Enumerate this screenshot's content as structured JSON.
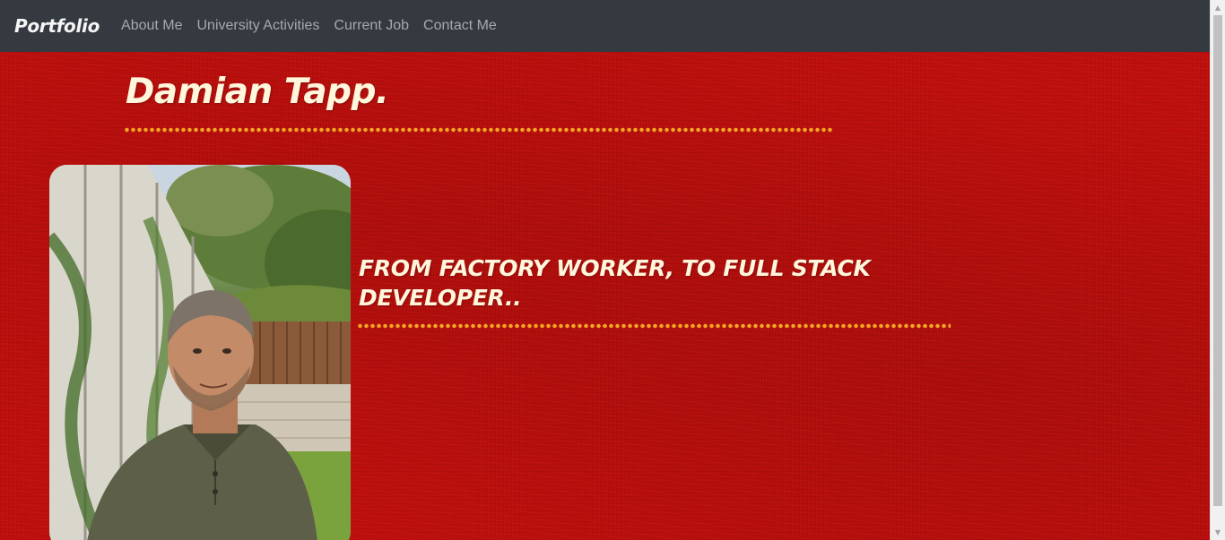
{
  "navbar": {
    "brand": "Portfolio",
    "links": [
      "About Me",
      "University Activities",
      "Current Job",
      "Contact Me"
    ]
  },
  "hero": {
    "name": "Damian Tapp.",
    "tagline": "FROM FACTORY WORKER, TO FULL STACK DEVELOPER..",
    "photo_icon": "profile-photo"
  },
  "colors": {
    "navbar_bg": "#343a40",
    "page_bg": "#c3100e",
    "heading_text": "#fff6dc",
    "dots_accent": "#f5a623",
    "nav_link": "#a6a9ac"
  }
}
